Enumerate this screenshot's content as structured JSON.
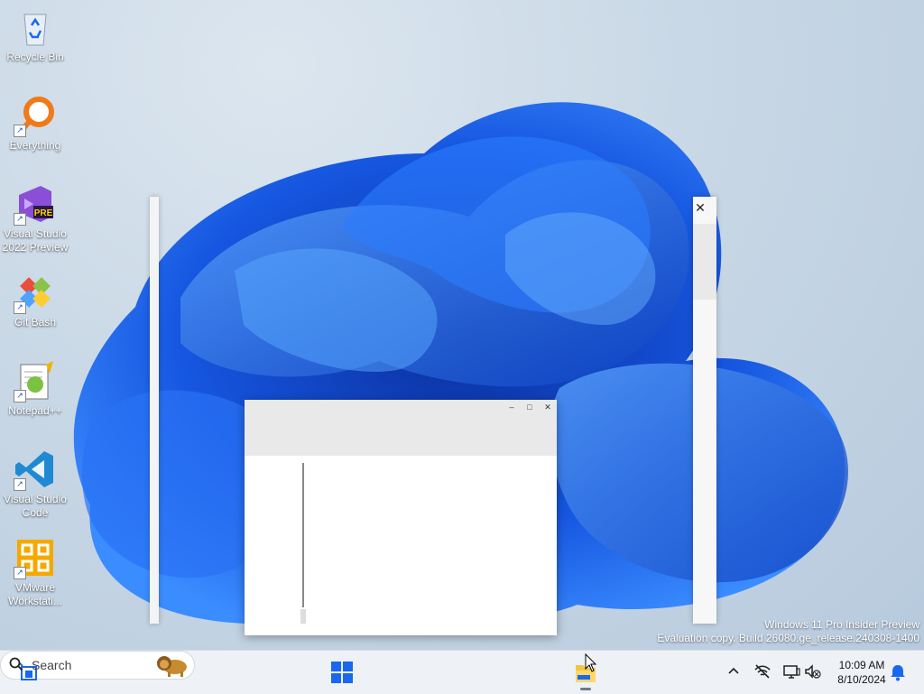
{
  "desktop": {
    "icons": [
      {
        "label": "Recycle Bin",
        "icon": "recycle-bin-icon"
      },
      {
        "label": "Everything",
        "icon": "everything-search-icon"
      },
      {
        "label": "Visual Studio 2022 Preview",
        "icon": "visual-studio-preview-icon",
        "badge": "PRE"
      },
      {
        "label": "Git Bash",
        "icon": "git-bash-icon"
      },
      {
        "label": "Notepad++",
        "icon": "notepad-plus-plus-icon"
      },
      {
        "label": "Visual Studio Code",
        "icon": "vscode-icon"
      },
      {
        "label": "VMware Workstati...",
        "icon": "vmware-workstation-icon"
      }
    ],
    "watermark": {
      "line1": "Windows 11 Pro Insider Preview",
      "line2": "Evaluation copy. Build 26080.ge_release.240308-1400"
    }
  },
  "windows": {
    "right_panel_close": "✕",
    "dialog_controls": {
      "minimize": "–",
      "maximize": "□",
      "close": "✕"
    }
  },
  "taskbar": {
    "search_placeholder": "Search",
    "clock_time": "10:09 AM",
    "clock_date": "8/10/2024"
  },
  "colors": {
    "accent": "#1a67f0",
    "taskbar_bg": "#eef2f6",
    "bloom_dark": "#0a3fb8",
    "bloom_light": "#3b8cff"
  }
}
